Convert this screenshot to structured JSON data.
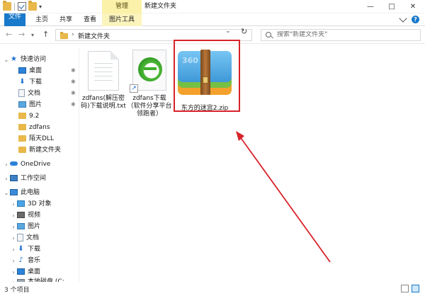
{
  "titlebar": {
    "manage_tab": "管理",
    "window_title": "新建文件夹",
    "minimize": "—",
    "maximize": "□",
    "close": "✕",
    "qat_arrow": "▾"
  },
  "ribbon": {
    "tabs": [
      {
        "label": "文件"
      },
      {
        "label": "主页"
      },
      {
        "label": "共享"
      },
      {
        "label": "查看"
      },
      {
        "label": "图片工具"
      }
    ],
    "help": "?"
  },
  "address": {
    "back": "←",
    "forward": "→",
    "recent": "▾",
    "up": "↑",
    "separator": "›",
    "path": "新建文件夹",
    "dropdown": "⌄",
    "refresh": "↻",
    "search_placeholder": "搜索\"新建文件夹\""
  },
  "sidebar": {
    "expand": "›",
    "collapse": "⌄",
    "pin": "✱",
    "quick_access": "快速访问",
    "quick_items": [
      {
        "label": "桌面",
        "icon": "desktop-icon",
        "pinned": true
      },
      {
        "label": "下载",
        "icon": "download-icon",
        "pinned": true
      },
      {
        "label": "文档",
        "icon": "document-icon",
        "pinned": true
      },
      {
        "label": "图片",
        "icon": "picture-icon",
        "pinned": true
      },
      {
        "label": "9.2",
        "icon": "folder-icon",
        "pinned": false
      },
      {
        "label": "zdfans",
        "icon": "folder-icon",
        "pinned": false
      },
      {
        "label": "陌天DLL",
        "icon": "folder-icon",
        "pinned": false
      },
      {
        "label": "新建文件夹",
        "icon": "folder-icon",
        "pinned": false
      }
    ],
    "onedrive": "OneDrive",
    "workspace": "工作空间",
    "this_pc": "此电脑",
    "pc_items": [
      {
        "label": "3D 对象",
        "icon": "3d-objects-icon"
      },
      {
        "label": "视频",
        "icon": "video-icon"
      },
      {
        "label": "图片",
        "icon": "picture-icon"
      },
      {
        "label": "文档",
        "icon": "document-icon"
      },
      {
        "label": "下载",
        "icon": "download-icon"
      },
      {
        "label": "音乐",
        "icon": "music-icon"
      },
      {
        "label": "桌面",
        "icon": "desktop-icon"
      },
      {
        "label": "本地磁盘 (C:",
        "icon": "disk-icon"
      }
    ]
  },
  "files": [
    {
      "name": "zdfans(解压密码)下载说明.txt",
      "type": "text-file"
    },
    {
      "name": "zdfans下载（软件分享平台领跑者）",
      "type": "shortcut"
    },
    {
      "name": "东方的迷宫2.zip",
      "type": "zip-archive",
      "highlighted": true,
      "icon_caption": "360"
    }
  ],
  "status": {
    "item_count": "3 个项目"
  },
  "colors": {
    "accent": "#1979ca",
    "highlight_border": "#d8232a",
    "manage_tab_bg": "#fbf1a8",
    "selection_bg": "#cce8ff"
  }
}
